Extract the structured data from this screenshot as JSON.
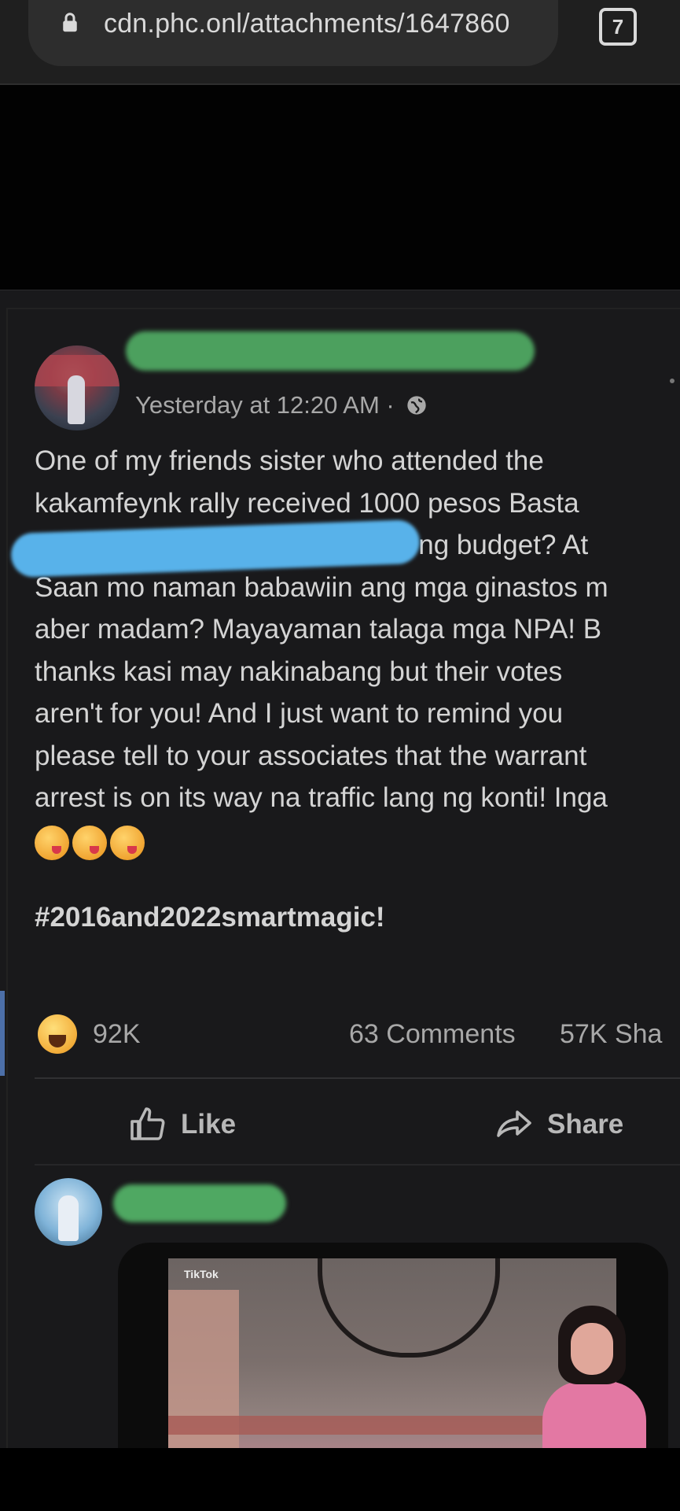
{
  "browser": {
    "url": "cdn.phc.onl/attachments/1647860",
    "tab_count": "7",
    "icons": {
      "lock": "lock-icon",
      "tabs": "tab-switcher-icon"
    }
  },
  "post": {
    "timestamp": "Yesterday at 12:20 AM · ",
    "body_lines": [
      "One of my friends sister who attended the",
      "kakamfeynk rally received 1000 pesos Basta",
      "laki ng budget? At",
      "Saan mo naman babawiin ang mga ginastos m",
      "aber madam? Mayayaman talaga mga NPA! B",
      "thanks kasi may nakinabang but their votes",
      "aren't for you! And I just want to remind you",
      "please tell to your associates that the warrant",
      "arrest is on its way na traffic lang ng konti! Inga"
    ],
    "hashtag": "#2016and2022smartmagic!",
    "reactions_count": "92K",
    "comments_count": "63 Comments",
    "shares_count": "57K Sha",
    "actions": {
      "like_label": "Like",
      "share_label": "Share"
    },
    "colors": {
      "redaction_green": "#4fa862",
      "redaction_blue": "#58b2ea",
      "background": "#19191b"
    }
  },
  "next_post": {
    "video_watermark": "TikTok"
  }
}
